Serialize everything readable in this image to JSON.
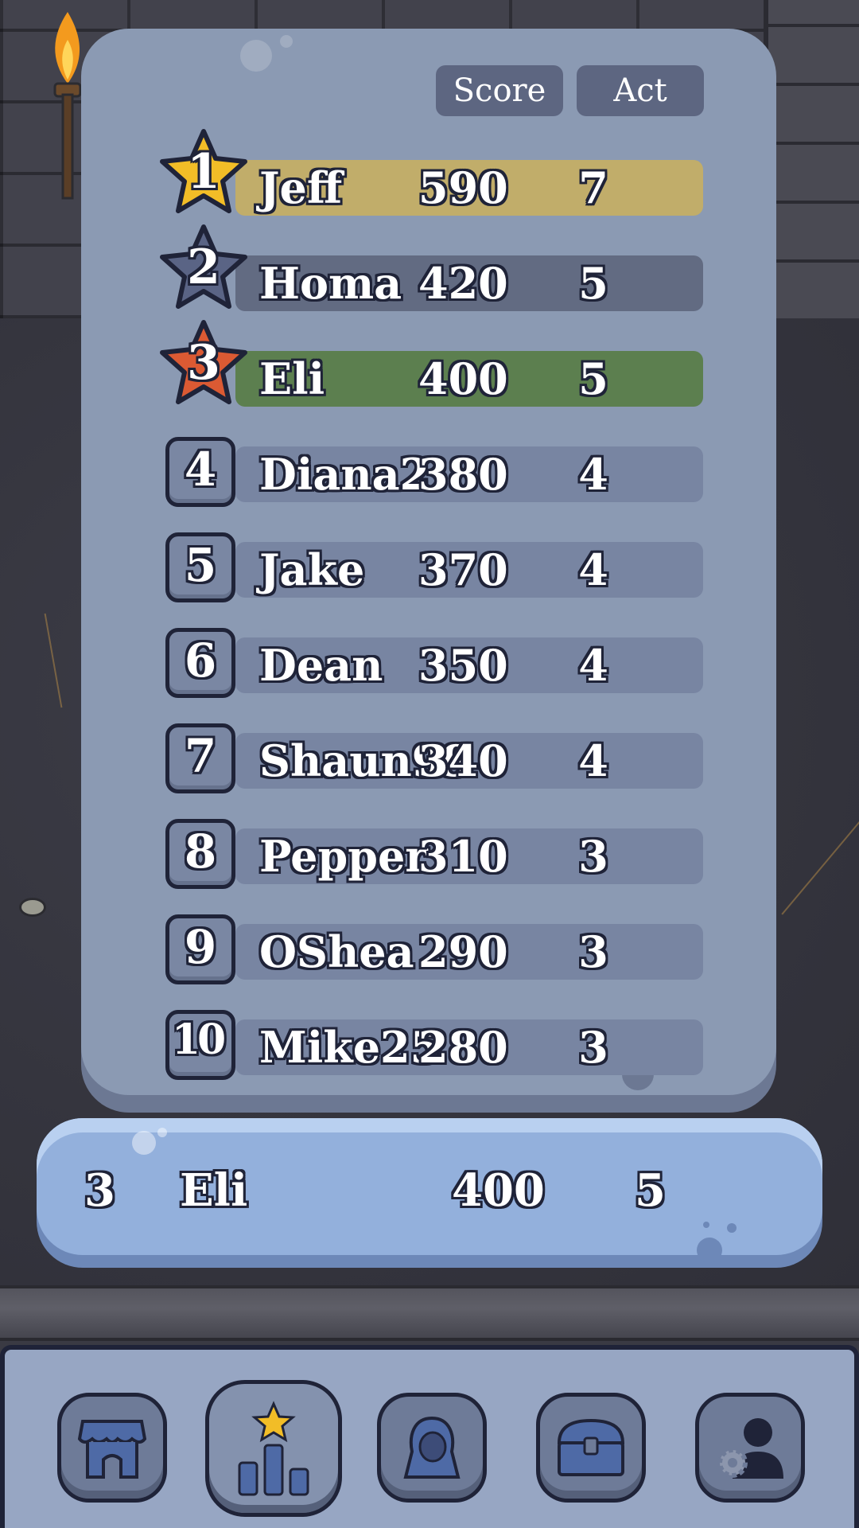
{
  "leaderboard": {
    "columns": {
      "score": "Score",
      "act": "Act"
    },
    "rows": [
      {
        "rank": "1",
        "name": "Jeff",
        "score": "590",
        "act": "7"
      },
      {
        "rank": "2",
        "name": "Homa",
        "score": "420",
        "act": "5"
      },
      {
        "rank": "3",
        "name": "Eli",
        "score": "400",
        "act": "5"
      },
      {
        "rank": "4",
        "name": "Diana2",
        "score": "380",
        "act": "4"
      },
      {
        "rank": "5",
        "name": "Jake",
        "score": "370",
        "act": "4"
      },
      {
        "rank": "6",
        "name": "Dean",
        "score": "350",
        "act": "4"
      },
      {
        "rank": "7",
        "name": "Shaun99",
        "score": "340",
        "act": "4"
      },
      {
        "rank": "8",
        "name": "Pepper",
        "score": "310",
        "act": "3"
      },
      {
        "rank": "9",
        "name": "OShea",
        "score": "290",
        "act": "3"
      },
      {
        "rank": "10",
        "name": "Mike25",
        "score": "280",
        "act": "3"
      }
    ]
  },
  "current_player": {
    "rank": "3",
    "name": "Eli",
    "score": "400",
    "act": "5"
  },
  "colors": {
    "gold_row": "#c1ad6a",
    "silver_row": "#626b82",
    "bronze_row": "#5c7f4f",
    "default_row": "#7885a2",
    "gold_star": "#f2bd27",
    "silver_star": "#5a6485",
    "bronze_star": "#db5a33"
  },
  "nav": {
    "items": [
      {
        "icon": "shop-icon",
        "active": false
      },
      {
        "icon": "leaderboard-icon",
        "active": true
      },
      {
        "icon": "character-icon",
        "active": false
      },
      {
        "icon": "chest-icon",
        "active": false
      },
      {
        "icon": "profile-settings-icon",
        "active": false
      }
    ]
  }
}
